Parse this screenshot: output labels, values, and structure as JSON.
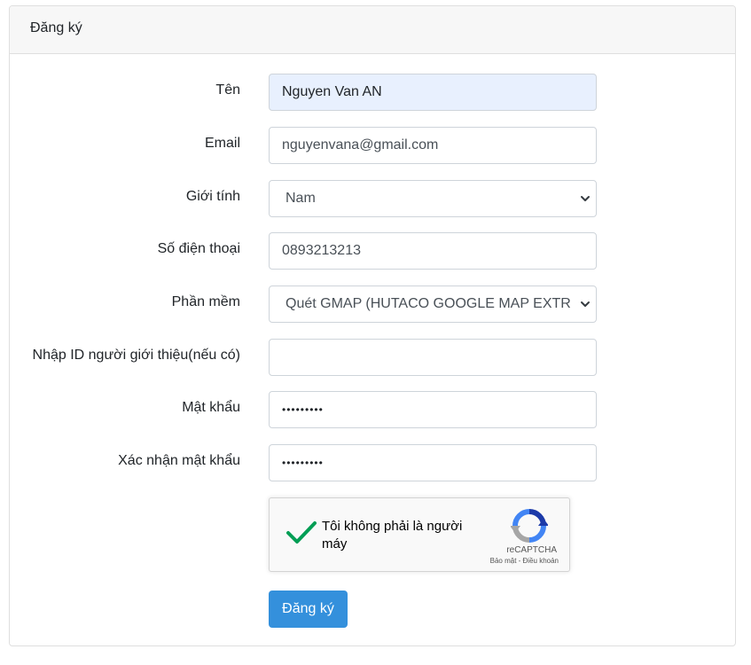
{
  "header": {
    "title": "Đăng ký"
  },
  "form": {
    "name": {
      "label": "Tên",
      "value": "Nguyen Van AN"
    },
    "email": {
      "label": "Email",
      "value": "nguyenvana@gmail.com"
    },
    "gender": {
      "label": "Giới tính",
      "selected": "Nam"
    },
    "phone": {
      "label": "Số điện thoại",
      "value": "0893213213"
    },
    "software": {
      "label": "Phần mềm",
      "selected": "Quét GMAP (HUTACO GOOGLE MAP EXTR"
    },
    "referral": {
      "label": "Nhập ID người giới thiệu(nếu có)",
      "value": ""
    },
    "password": {
      "label": "Mật khẩu",
      "masked": "•••••••••"
    },
    "confirm_password": {
      "label": "Xác nhận mật khẩu",
      "masked": "•••••••••"
    }
  },
  "recaptcha": {
    "text": "Tôi không phải là người máy",
    "brand": "reCAPTCHA",
    "links": "Bảo mật - Điều khoản",
    "checked": true
  },
  "submit_label": "Đăng ký",
  "colors": {
    "primary": "#3490dc",
    "autofill": "#e8f0fe",
    "check": "#009e55"
  }
}
